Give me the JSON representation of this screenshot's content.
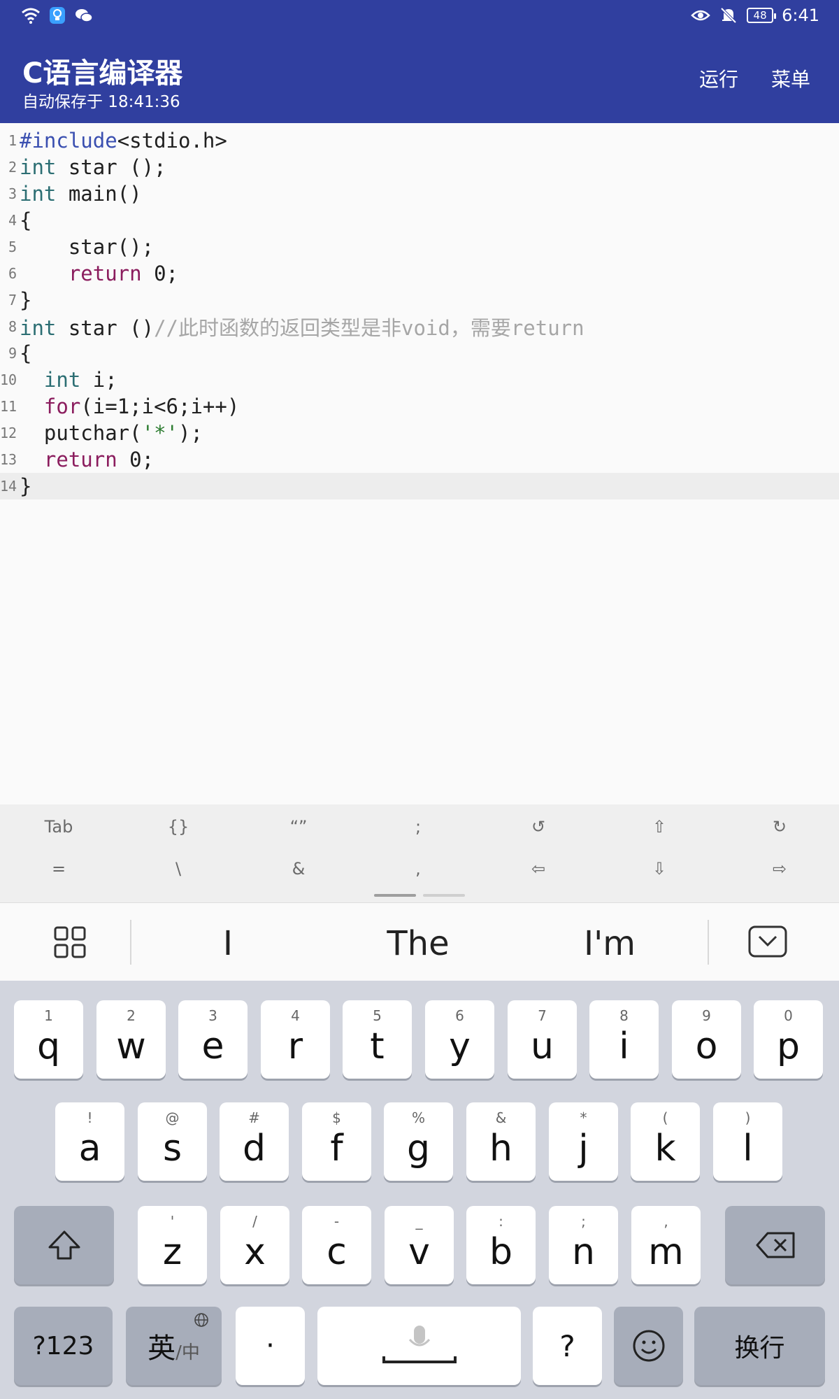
{
  "status_bar": {
    "battery": "48",
    "time": "6:41"
  },
  "app_bar": {
    "title": "C语言编译器",
    "subtitle": "自动保存于 18:41:36",
    "run_label": "运行",
    "menu_label": "菜单"
  },
  "editor": {
    "lines": [
      {
        "num": "1",
        "tokens": [
          [
            "kw-inc",
            "#include"
          ],
          [
            "",
            "<stdio.h>"
          ]
        ]
      },
      {
        "num": "2",
        "tokens": [
          [
            "kw-type",
            "int"
          ],
          [
            "",
            " star ();"
          ]
        ]
      },
      {
        "num": "3",
        "tokens": [
          [
            "kw-type",
            "int"
          ],
          [
            "",
            " main()"
          ]
        ]
      },
      {
        "num": "4",
        "tokens": [
          [
            "",
            "{"
          ]
        ]
      },
      {
        "num": "5",
        "tokens": [
          [
            "",
            "    star();"
          ]
        ]
      },
      {
        "num": "6",
        "tokens": [
          [
            "",
            "    "
          ],
          [
            "kw-ctrl",
            "return"
          ],
          [
            "",
            " 0;"
          ]
        ]
      },
      {
        "num": "7",
        "tokens": [
          [
            "",
            "}"
          ]
        ]
      },
      {
        "num": "8",
        "tokens": [
          [
            "kw-type",
            "int"
          ],
          [
            "",
            " star ()"
          ],
          [
            "cm",
            "//此时函数的返回类型是非void，需要return"
          ]
        ]
      },
      {
        "num": "9",
        "tokens": [
          [
            "",
            "{"
          ]
        ]
      },
      {
        "num": "10",
        "tokens": [
          [
            "",
            "  "
          ],
          [
            "kw-type",
            "int"
          ],
          [
            "",
            " i;"
          ]
        ]
      },
      {
        "num": "11",
        "tokens": [
          [
            "",
            "  "
          ],
          [
            "kw-ctrl",
            "for"
          ],
          [
            "",
            "(i=1;i<6;i++)"
          ]
        ]
      },
      {
        "num": "12",
        "tokens": [
          [
            "",
            "  putchar("
          ],
          [
            "str",
            "'*'"
          ],
          [
            "",
            ");"
          ]
        ]
      },
      {
        "num": "13",
        "tokens": [
          [
            "",
            "  "
          ],
          [
            "kw-ctrl",
            "return"
          ],
          [
            "",
            " 0;"
          ]
        ]
      },
      {
        "num": "14",
        "tokens": [
          [
            "",
            "}"
          ]
        ]
      }
    ]
  },
  "symbols": {
    "row1": [
      "Tab",
      "{}",
      "“”",
      ";",
      "↺",
      "⇧",
      "↻"
    ],
    "row2": [
      "=",
      "\\",
      "&",
      ",",
      "⇦",
      "⇩",
      "⇨"
    ]
  },
  "suggestions": [
    "I",
    "The",
    "I'm"
  ],
  "keyboard": {
    "row1": [
      [
        "1",
        "q"
      ],
      [
        "2",
        "w"
      ],
      [
        "3",
        "e"
      ],
      [
        "4",
        "r"
      ],
      [
        "5",
        "t"
      ],
      [
        "6",
        "y"
      ],
      [
        "7",
        "u"
      ],
      [
        "8",
        "i"
      ],
      [
        "9",
        "o"
      ],
      [
        "0",
        "p"
      ]
    ],
    "row2": [
      [
        "!",
        "a"
      ],
      [
        "@",
        "s"
      ],
      [
        "#",
        "d"
      ],
      [
        "$",
        "f"
      ],
      [
        "%",
        "g"
      ],
      [
        "&",
        "h"
      ],
      [
        "*",
        "j"
      ],
      [
        "(",
        "k"
      ],
      [
        ")",
        "l"
      ]
    ],
    "row3": [
      [
        "'",
        "z"
      ],
      [
        "/",
        "x"
      ],
      [
        "-",
        "c"
      ],
      [
        "_",
        "v"
      ],
      [
        ":",
        "b"
      ],
      [
        ";",
        "n"
      ],
      [
        ",",
        "m"
      ]
    ],
    "num_label": "?123",
    "lang_main": "英",
    "lang_sub": "/中",
    "dot_label": "·",
    "question_label": "?",
    "enter_label": "换行"
  }
}
